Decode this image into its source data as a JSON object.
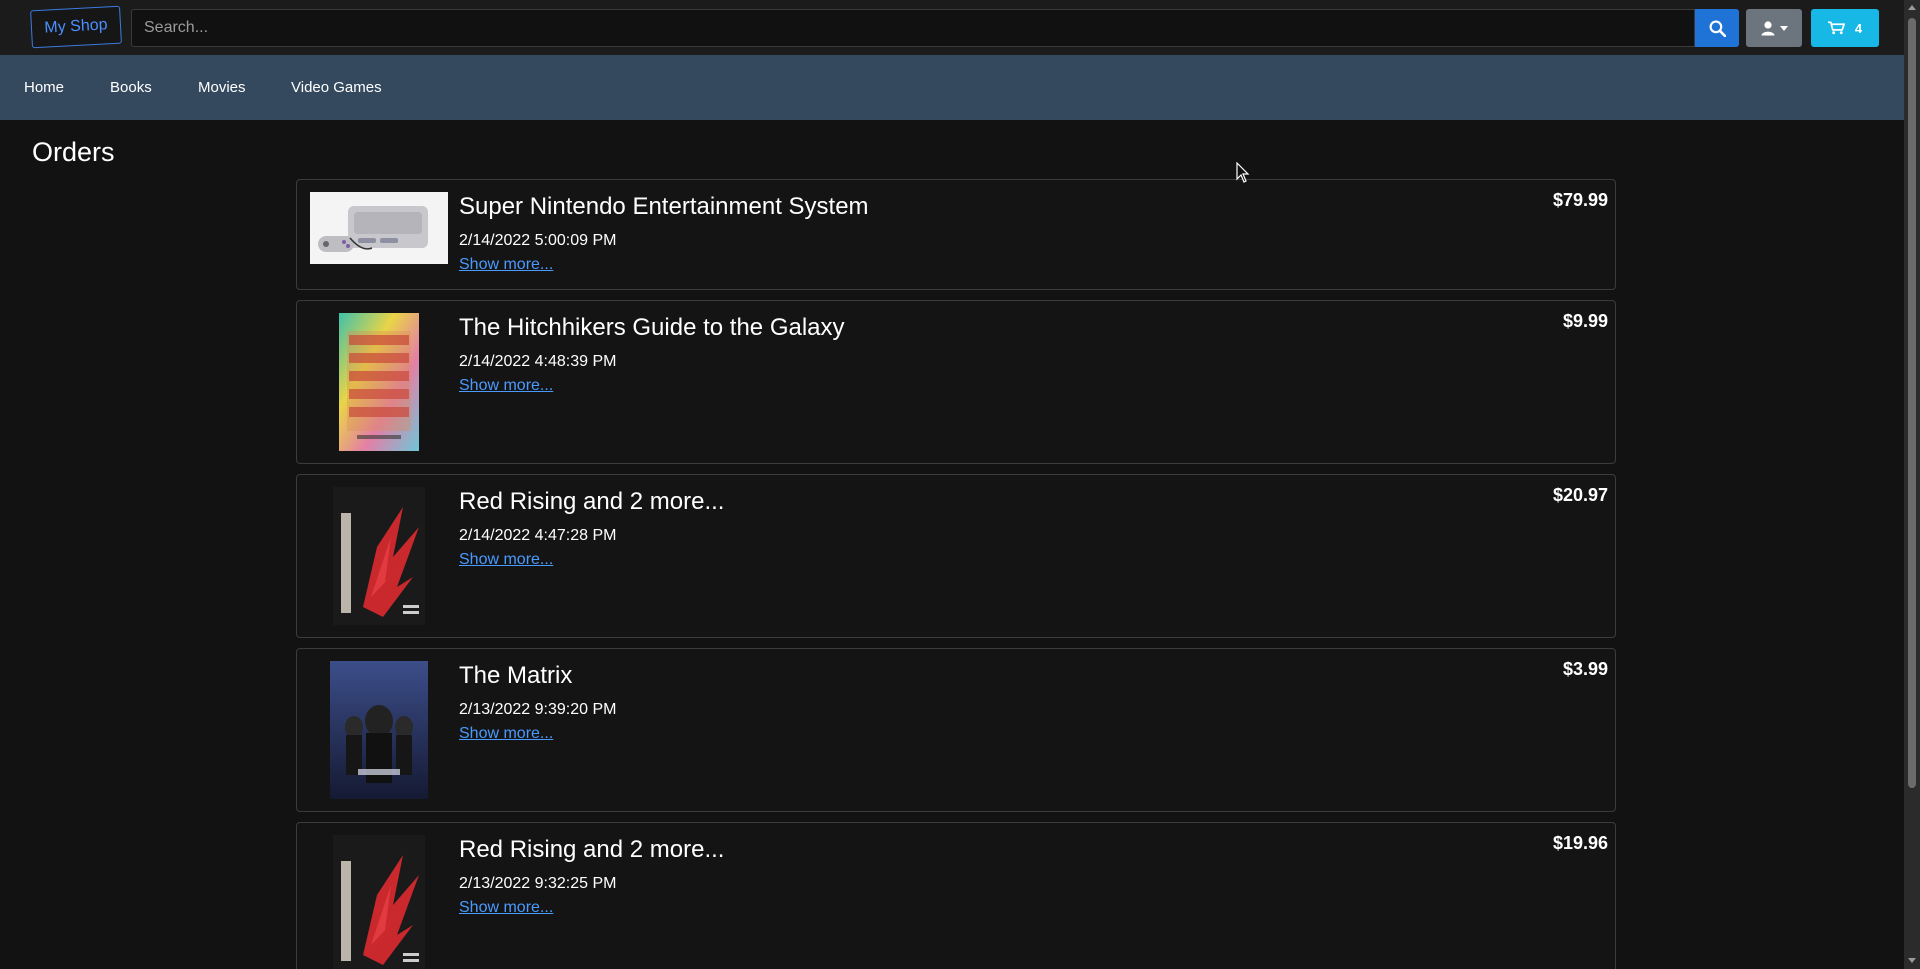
{
  "header": {
    "brand": "My Shop",
    "search_placeholder": "Search...",
    "search_icon": "search-icon",
    "user_icon": "user-icon",
    "cart_icon": "cart-icon",
    "cart_count": "4",
    "colors": {
      "brand": "#4a90ff",
      "search_btn": "#1f73d6",
      "user_btn": "#6c757d",
      "cart_btn": "#17b8e6",
      "nav_bg": "#35495e"
    }
  },
  "nav": {
    "items": [
      {
        "label": "Home"
      },
      {
        "label": "Books"
      },
      {
        "label": "Movies"
      },
      {
        "label": "Video Games"
      }
    ]
  },
  "page": {
    "title": "Orders"
  },
  "orders": [
    {
      "title": "Super Nintendo Entertainment System",
      "date": "2/14/2022 5:00:09 PM",
      "more": "Show more...",
      "price": "$79.99",
      "thumb": "snes-console-image"
    },
    {
      "title": "The Hitchhikers Guide to the Galaxy",
      "date": "2/14/2022 4:48:39 PM",
      "more": "Show more...",
      "price": "$9.99",
      "thumb": "hitchhikers-book-cover"
    },
    {
      "title": "Red Rising and 2 more...",
      "date": "2/14/2022 4:47:28 PM",
      "more": "Show more...",
      "price": "$20.97",
      "thumb": "red-rising-book-cover"
    },
    {
      "title": "The Matrix",
      "date": "2/13/2022 9:39:20 PM",
      "more": "Show more...",
      "price": "$3.99",
      "thumb": "matrix-movie-poster"
    },
    {
      "title": "Red Rising and 2 more...",
      "date": "2/13/2022 9:32:25 PM",
      "more": "Show more...",
      "price": "$19.96",
      "thumb": "red-rising-book-cover"
    }
  ]
}
